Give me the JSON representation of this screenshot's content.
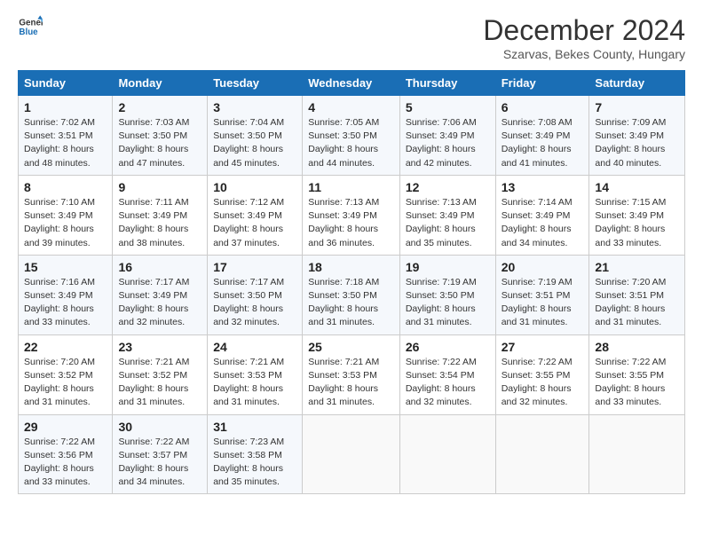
{
  "logo": {
    "line1": "General",
    "line2": "Blue"
  },
  "title": "December 2024",
  "subtitle": "Szarvas, Bekes County, Hungary",
  "days_header": [
    "Sunday",
    "Monday",
    "Tuesday",
    "Wednesday",
    "Thursday",
    "Friday",
    "Saturday"
  ],
  "weeks": [
    [
      {
        "day": "1",
        "sunrise": "Sunrise: 7:02 AM",
        "sunset": "Sunset: 3:51 PM",
        "daylight": "Daylight: 8 hours and 48 minutes."
      },
      {
        "day": "2",
        "sunrise": "Sunrise: 7:03 AM",
        "sunset": "Sunset: 3:50 PM",
        "daylight": "Daylight: 8 hours and 47 minutes."
      },
      {
        "day": "3",
        "sunrise": "Sunrise: 7:04 AM",
        "sunset": "Sunset: 3:50 PM",
        "daylight": "Daylight: 8 hours and 45 minutes."
      },
      {
        "day": "4",
        "sunrise": "Sunrise: 7:05 AM",
        "sunset": "Sunset: 3:50 PM",
        "daylight": "Daylight: 8 hours and 44 minutes."
      },
      {
        "day": "5",
        "sunrise": "Sunrise: 7:06 AM",
        "sunset": "Sunset: 3:49 PM",
        "daylight": "Daylight: 8 hours and 42 minutes."
      },
      {
        "day": "6",
        "sunrise": "Sunrise: 7:08 AM",
        "sunset": "Sunset: 3:49 PM",
        "daylight": "Daylight: 8 hours and 41 minutes."
      },
      {
        "day": "7",
        "sunrise": "Sunrise: 7:09 AM",
        "sunset": "Sunset: 3:49 PM",
        "daylight": "Daylight: 8 hours and 40 minutes."
      }
    ],
    [
      {
        "day": "8",
        "sunrise": "Sunrise: 7:10 AM",
        "sunset": "Sunset: 3:49 PM",
        "daylight": "Daylight: 8 hours and 39 minutes."
      },
      {
        "day": "9",
        "sunrise": "Sunrise: 7:11 AM",
        "sunset": "Sunset: 3:49 PM",
        "daylight": "Daylight: 8 hours and 38 minutes."
      },
      {
        "day": "10",
        "sunrise": "Sunrise: 7:12 AM",
        "sunset": "Sunset: 3:49 PM",
        "daylight": "Daylight: 8 hours and 37 minutes."
      },
      {
        "day": "11",
        "sunrise": "Sunrise: 7:13 AM",
        "sunset": "Sunset: 3:49 PM",
        "daylight": "Daylight: 8 hours and 36 minutes."
      },
      {
        "day": "12",
        "sunrise": "Sunrise: 7:13 AM",
        "sunset": "Sunset: 3:49 PM",
        "daylight": "Daylight: 8 hours and 35 minutes."
      },
      {
        "day": "13",
        "sunrise": "Sunrise: 7:14 AM",
        "sunset": "Sunset: 3:49 PM",
        "daylight": "Daylight: 8 hours and 34 minutes."
      },
      {
        "day": "14",
        "sunrise": "Sunrise: 7:15 AM",
        "sunset": "Sunset: 3:49 PM",
        "daylight": "Daylight: 8 hours and 33 minutes."
      }
    ],
    [
      {
        "day": "15",
        "sunrise": "Sunrise: 7:16 AM",
        "sunset": "Sunset: 3:49 PM",
        "daylight": "Daylight: 8 hours and 33 minutes."
      },
      {
        "day": "16",
        "sunrise": "Sunrise: 7:17 AM",
        "sunset": "Sunset: 3:49 PM",
        "daylight": "Daylight: 8 hours and 32 minutes."
      },
      {
        "day": "17",
        "sunrise": "Sunrise: 7:17 AM",
        "sunset": "Sunset: 3:50 PM",
        "daylight": "Daylight: 8 hours and 32 minutes."
      },
      {
        "day": "18",
        "sunrise": "Sunrise: 7:18 AM",
        "sunset": "Sunset: 3:50 PM",
        "daylight": "Daylight: 8 hours and 31 minutes."
      },
      {
        "day": "19",
        "sunrise": "Sunrise: 7:19 AM",
        "sunset": "Sunset: 3:50 PM",
        "daylight": "Daylight: 8 hours and 31 minutes."
      },
      {
        "day": "20",
        "sunrise": "Sunrise: 7:19 AM",
        "sunset": "Sunset: 3:51 PM",
        "daylight": "Daylight: 8 hours and 31 minutes."
      },
      {
        "day": "21",
        "sunrise": "Sunrise: 7:20 AM",
        "sunset": "Sunset: 3:51 PM",
        "daylight": "Daylight: 8 hours and 31 minutes."
      }
    ],
    [
      {
        "day": "22",
        "sunrise": "Sunrise: 7:20 AM",
        "sunset": "Sunset: 3:52 PM",
        "daylight": "Daylight: 8 hours and 31 minutes."
      },
      {
        "day": "23",
        "sunrise": "Sunrise: 7:21 AM",
        "sunset": "Sunset: 3:52 PM",
        "daylight": "Daylight: 8 hours and 31 minutes."
      },
      {
        "day": "24",
        "sunrise": "Sunrise: 7:21 AM",
        "sunset": "Sunset: 3:53 PM",
        "daylight": "Daylight: 8 hours and 31 minutes."
      },
      {
        "day": "25",
        "sunrise": "Sunrise: 7:21 AM",
        "sunset": "Sunset: 3:53 PM",
        "daylight": "Daylight: 8 hours and 31 minutes."
      },
      {
        "day": "26",
        "sunrise": "Sunrise: 7:22 AM",
        "sunset": "Sunset: 3:54 PM",
        "daylight": "Daylight: 8 hours and 32 minutes."
      },
      {
        "day": "27",
        "sunrise": "Sunrise: 7:22 AM",
        "sunset": "Sunset: 3:55 PM",
        "daylight": "Daylight: 8 hours and 32 minutes."
      },
      {
        "day": "28",
        "sunrise": "Sunrise: 7:22 AM",
        "sunset": "Sunset: 3:55 PM",
        "daylight": "Daylight: 8 hours and 33 minutes."
      }
    ],
    [
      {
        "day": "29",
        "sunrise": "Sunrise: 7:22 AM",
        "sunset": "Sunset: 3:56 PM",
        "daylight": "Daylight: 8 hours and 33 minutes."
      },
      {
        "day": "30",
        "sunrise": "Sunrise: 7:22 AM",
        "sunset": "Sunset: 3:57 PM",
        "daylight": "Daylight: 8 hours and 34 minutes."
      },
      {
        "day": "31",
        "sunrise": "Sunrise: 7:23 AM",
        "sunset": "Sunset: 3:58 PM",
        "daylight": "Daylight: 8 hours and 35 minutes."
      },
      null,
      null,
      null,
      null
    ]
  ]
}
